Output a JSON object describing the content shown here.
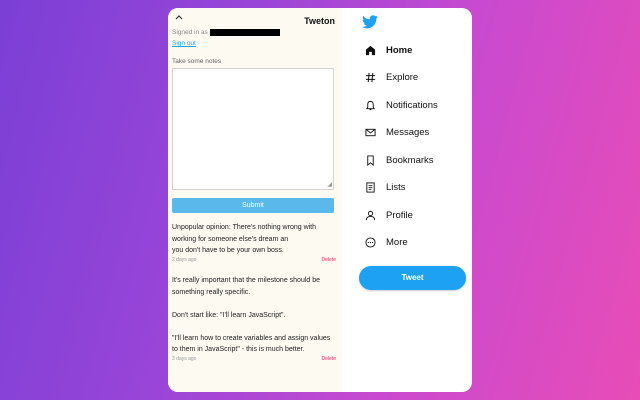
{
  "extension": {
    "title": "Tweton",
    "signed_in_label": "Signed in as",
    "sign_out": "Sign out",
    "notes_label": "Take some notes",
    "submit_label": "Submit",
    "notes": [
      {
        "text": "Unpopular opinion: There's nothing wrong with working for someone else's dream an\nyou don't have to be your own boss.",
        "time": "2 days ago",
        "delete": "Delete"
      },
      {
        "text": "It's really important that the milestone should be something really specific.\n\nDon't start like: \"I'll learn JavaScript\".\n\n\"I'll learn how to create variables and assign values to them in JavaScript\" - this is much better.",
        "time": "3 days ago",
        "delete": "Delete"
      }
    ]
  },
  "nav": {
    "logo": "twitter-logo",
    "items": [
      {
        "label": "Home",
        "icon": "home-icon",
        "active": true
      },
      {
        "label": "Explore",
        "icon": "hashtag-icon"
      },
      {
        "label": "Notifications",
        "icon": "bell-icon"
      },
      {
        "label": "Messages",
        "icon": "envelope-icon"
      },
      {
        "label": "Bookmarks",
        "icon": "bookmark-icon"
      },
      {
        "label": "Lists",
        "icon": "list-icon"
      },
      {
        "label": "Profile",
        "icon": "person-icon"
      },
      {
        "label": "More",
        "icon": "more-icon"
      }
    ],
    "tweet_label": "Tweet"
  },
  "colors": {
    "accent": "#1da1f2",
    "submit": "#5bb8ea",
    "delete": "#e0245e",
    "panel_bg": "#fdfaf2"
  }
}
